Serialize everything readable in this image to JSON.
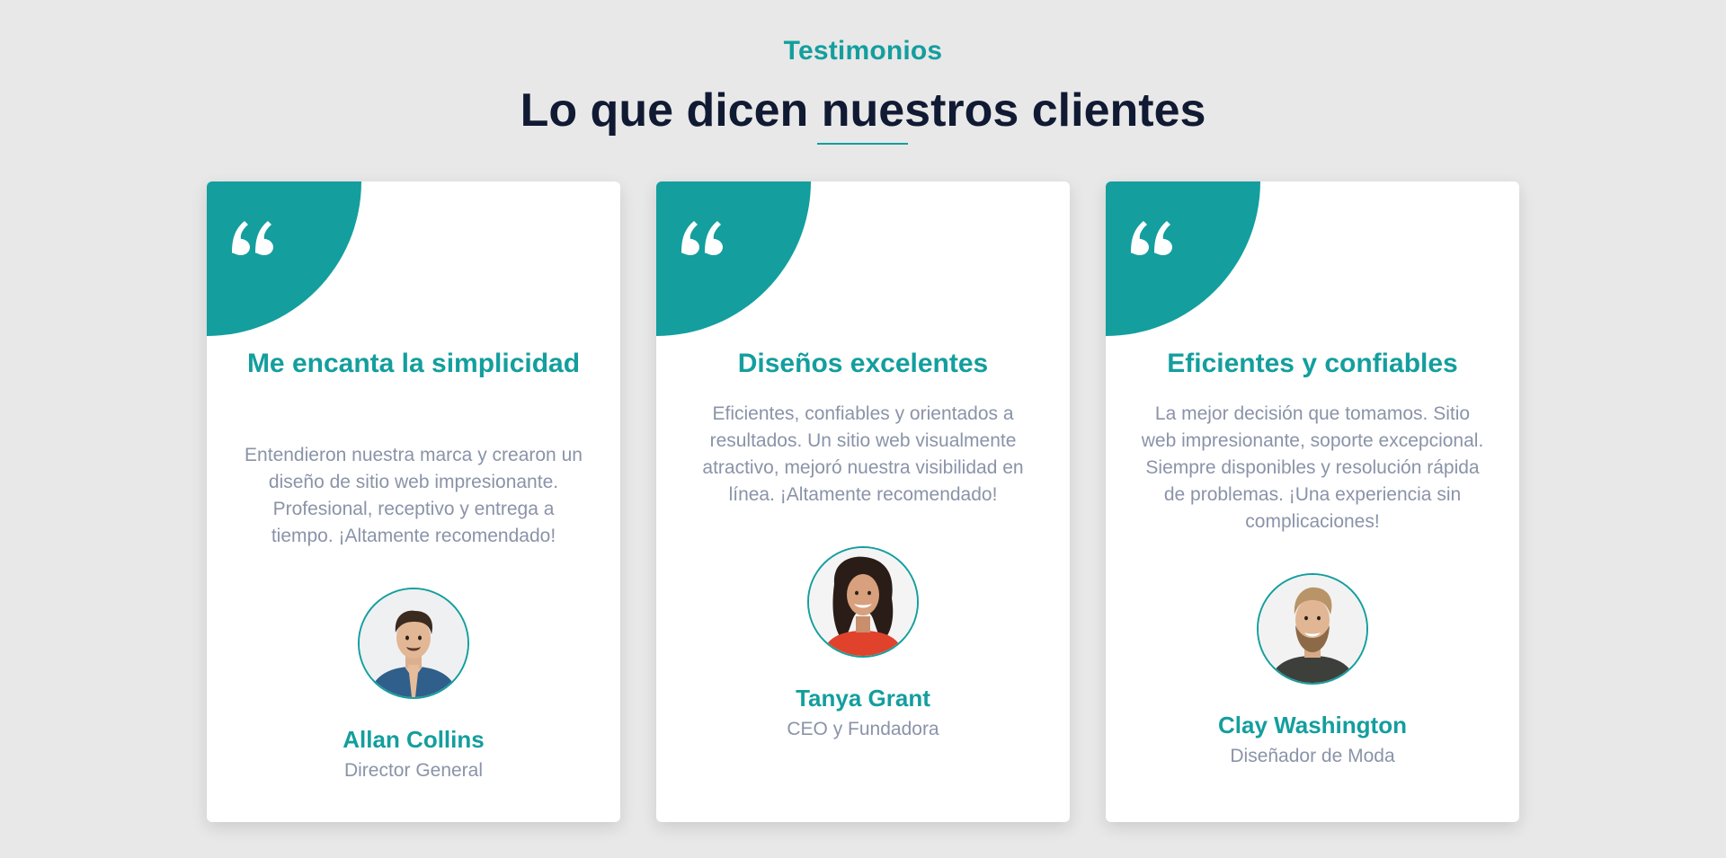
{
  "section": {
    "eyebrow": "Testimonios",
    "headline": "Lo que dicen nuestros clientes"
  },
  "colors": {
    "accent": "#149e9e",
    "heading": "#111a33",
    "muted_text": "#8a93a8",
    "background": "#e8e8e8",
    "card": "#ffffff"
  },
  "testimonials": [
    {
      "icon": "quote-icon",
      "title": "Me encanta la simplicidad",
      "text": "Entendieron nuestra marca y crearon un diseño de sitio web impresionante. Profesional, receptivo y entrega a tiempo. ¡Altamente recomendado!",
      "avatar": "avatar-photo-man-praying",
      "name": "Allan Collins",
      "role": "Director General"
    },
    {
      "icon": "quote-icon",
      "title": "Diseños excelentes",
      "text": "Eficientes, confiables y orientados a resultados. Un sitio web visualmente atractivo, mejoró nuestra visibilidad en línea. ¡Altamente recomendado!",
      "avatar": "avatar-photo-woman-smiling",
      "name": "Tanya Grant",
      "role": "CEO y Fundadora"
    },
    {
      "icon": "quote-icon",
      "title": "Eficientes y confiables",
      "text": "La mejor decisión que tomamos. Sitio web impresionante, soporte excepcional. Siempre disponibles y resolución rápida de problemas. ¡Una experiencia sin complicaciones!",
      "avatar": "avatar-photo-bearded-man",
      "name": "Clay Washington",
      "role": "Diseñador de Moda"
    }
  ]
}
